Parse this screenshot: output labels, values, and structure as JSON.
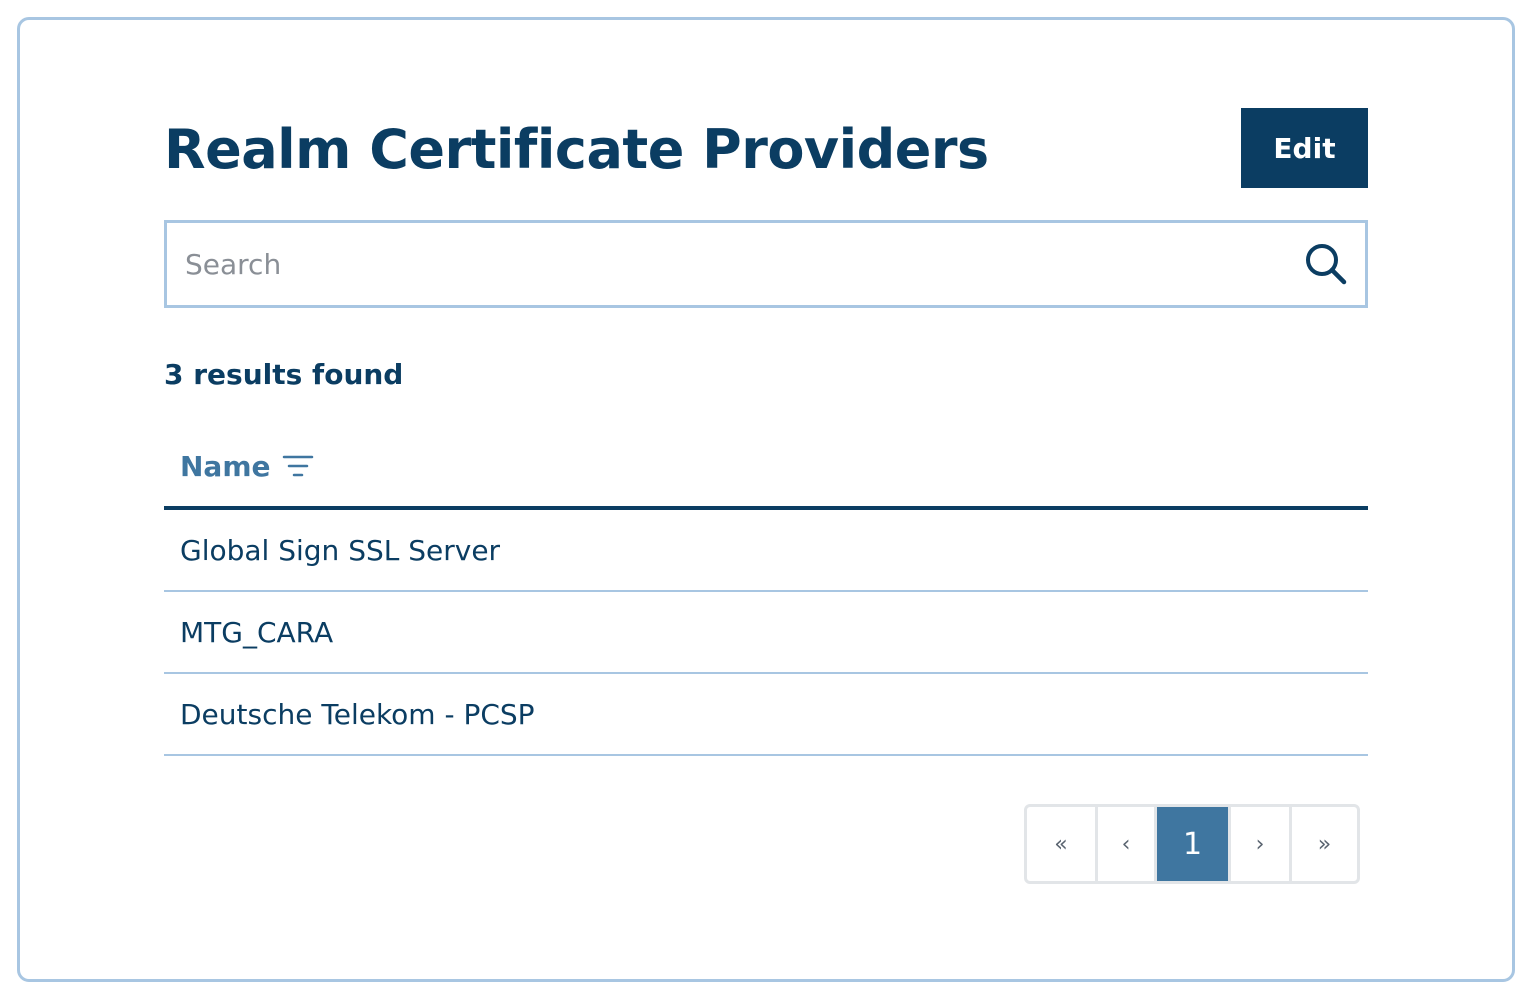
{
  "header": {
    "title": "Realm Certificate Providers",
    "edit_label": "Edit"
  },
  "search": {
    "placeholder": "Search",
    "value": ""
  },
  "results": {
    "count_text": "3 results found"
  },
  "table": {
    "columns": [
      "Name"
    ],
    "rows": [
      "Global Sign SSL Server",
      "MTG_CARA",
      "Deutsche Telekom - PCSP"
    ]
  },
  "pagination": {
    "first": "«",
    "prev": "‹",
    "current": "1",
    "next": "›",
    "last": "»"
  },
  "icons": {
    "search": "search-icon",
    "filter": "filter-icon"
  },
  "colors": {
    "primary": "#0b3d62",
    "accent": "#3f76a0",
    "border": "#a8c6e2"
  }
}
